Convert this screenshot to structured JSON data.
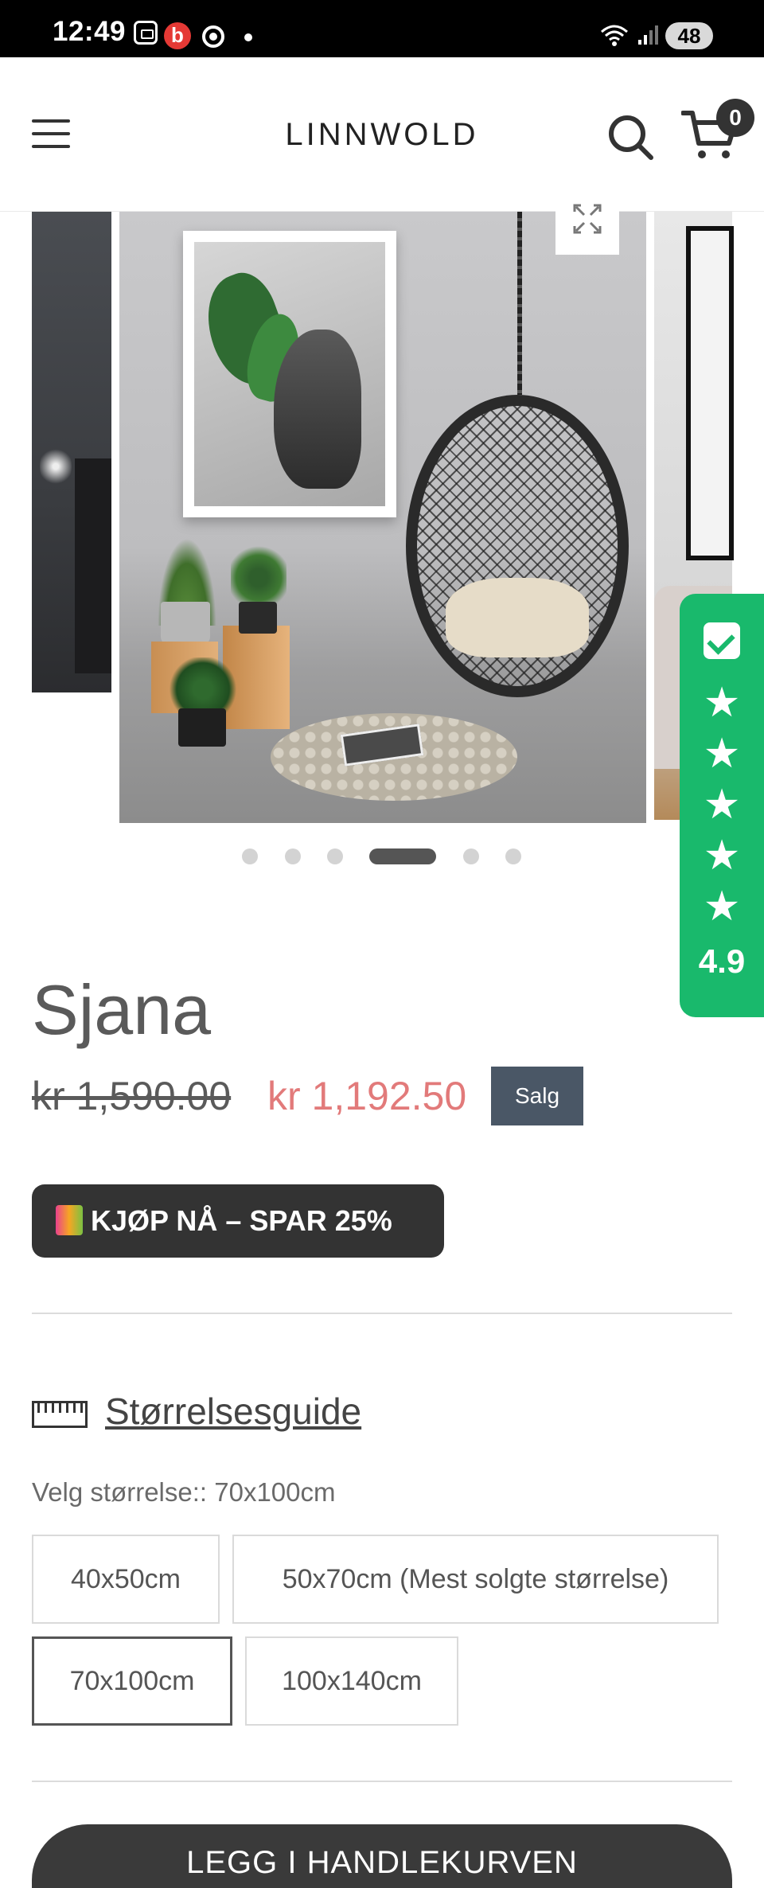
{
  "status_bar": {
    "time": "12:49",
    "battery": "48"
  },
  "header": {
    "logo": "LINNWOLD",
    "cart_count": "0"
  },
  "gallery": {
    "slide_count": 6,
    "active_slide": 4
  },
  "rating_widget": {
    "stars": 5,
    "score": "4.9"
  },
  "product": {
    "title": "Sjana",
    "price_old": "kr 1,590.00",
    "price_new": "kr 1,192.50",
    "sale_badge": "Salg",
    "promo_badge": "KJØP NÅ – SPAR 25%"
  },
  "size_guide": {
    "label": "Størrelsesguide"
  },
  "size_selector": {
    "label": "Velg størrelse:: 70x100cm",
    "options": [
      "40x50cm",
      "50x70cm (Mest solgte størrelse)",
      "70x100cm",
      "100x140cm"
    ],
    "selected": "70x100cm"
  },
  "add_to_cart": {
    "label": "LEGG I HANDLEKURVEN"
  },
  "colors": {
    "sale_price": "#e27a7a",
    "rating_green": "#19b96c",
    "sale_badge": "#4a5766"
  }
}
